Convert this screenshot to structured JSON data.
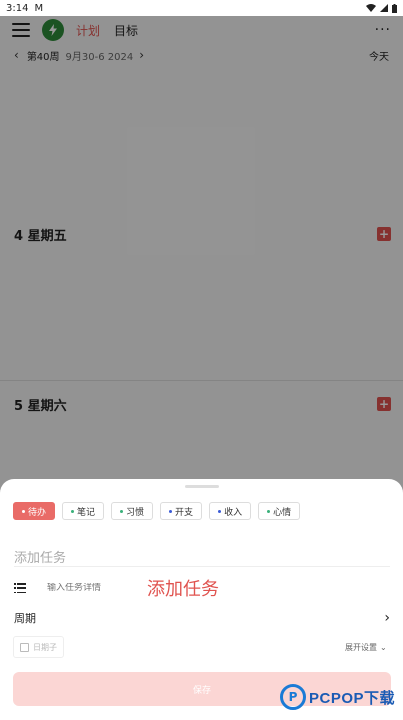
{
  "status_bar": {
    "time": "3:14",
    "mail_icon": "M"
  },
  "topbar": {
    "tabs": [
      {
        "label": "计划",
        "active": true
      },
      {
        "label": "目标",
        "active": false
      }
    ],
    "more": "···"
  },
  "weekbar": {
    "week": "第40周",
    "range": "9月30-6 2024",
    "today": "今天"
  },
  "days": [
    {
      "label": "4 星期五"
    },
    {
      "label": "5 星期六"
    }
  ],
  "sheet": {
    "chips": [
      {
        "label": "待办",
        "active": true,
        "dot_color": "#ffffff"
      },
      {
        "label": "笔记",
        "active": false,
        "dot_color": "#3ab07a"
      },
      {
        "label": "习惯",
        "active": false,
        "dot_color": "#3ab07a"
      },
      {
        "label": "开支",
        "active": false,
        "dot_color": "#3b5bd6"
      },
      {
        "label": "收入",
        "active": false,
        "dot_color": "#3b5bd6"
      },
      {
        "label": "心情",
        "active": false,
        "dot_color": "#3ab07a"
      }
    ],
    "task_title_placeholder": "添加任务",
    "detail_placeholder": "输入任务详情",
    "annotation": "添加任务",
    "cycle_label": "周期",
    "calendar_label": "日期子",
    "expand_label": "展开设置",
    "save_label": "保存"
  },
  "watermark": {
    "text": "PCPOP下载"
  },
  "colors": {
    "accent": "#e0534f",
    "save_disabled": "#fbd6d4",
    "logo_green": "#2e8b3a"
  }
}
